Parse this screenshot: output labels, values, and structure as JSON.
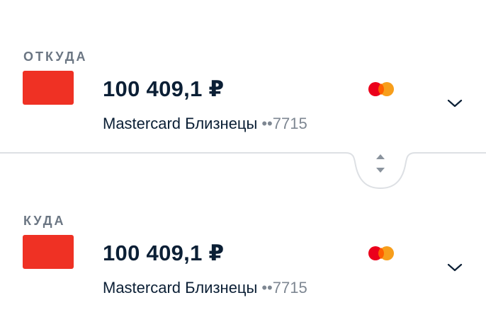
{
  "from": {
    "label": "ОТКУДА",
    "balance": "100 409,1 ₽",
    "card_name": "Mastercard Близнецы",
    "card_mask": "••7715",
    "card_color": "#ef3124",
    "payment_system_icon": "mastercard-logo",
    "expand_icon": "chevron-down-icon"
  },
  "to": {
    "label": "КУДА",
    "balance": "100 409,1 ₽",
    "card_name": "Mastercard Близнецы",
    "card_mask": "••7715",
    "card_color": "#ef3124",
    "payment_system_icon": "mastercard-logo",
    "expand_icon": "chevron-down-icon"
  },
  "swap": {
    "icon": "swap-vertical-icon"
  },
  "colors": {
    "text_primary": "#0b1f35",
    "text_secondary": "#6b7683",
    "card_red": "#ef3124",
    "mc_red": "#eb001b",
    "mc_orange": "#f79e1b",
    "divider": "#dde0e4"
  }
}
